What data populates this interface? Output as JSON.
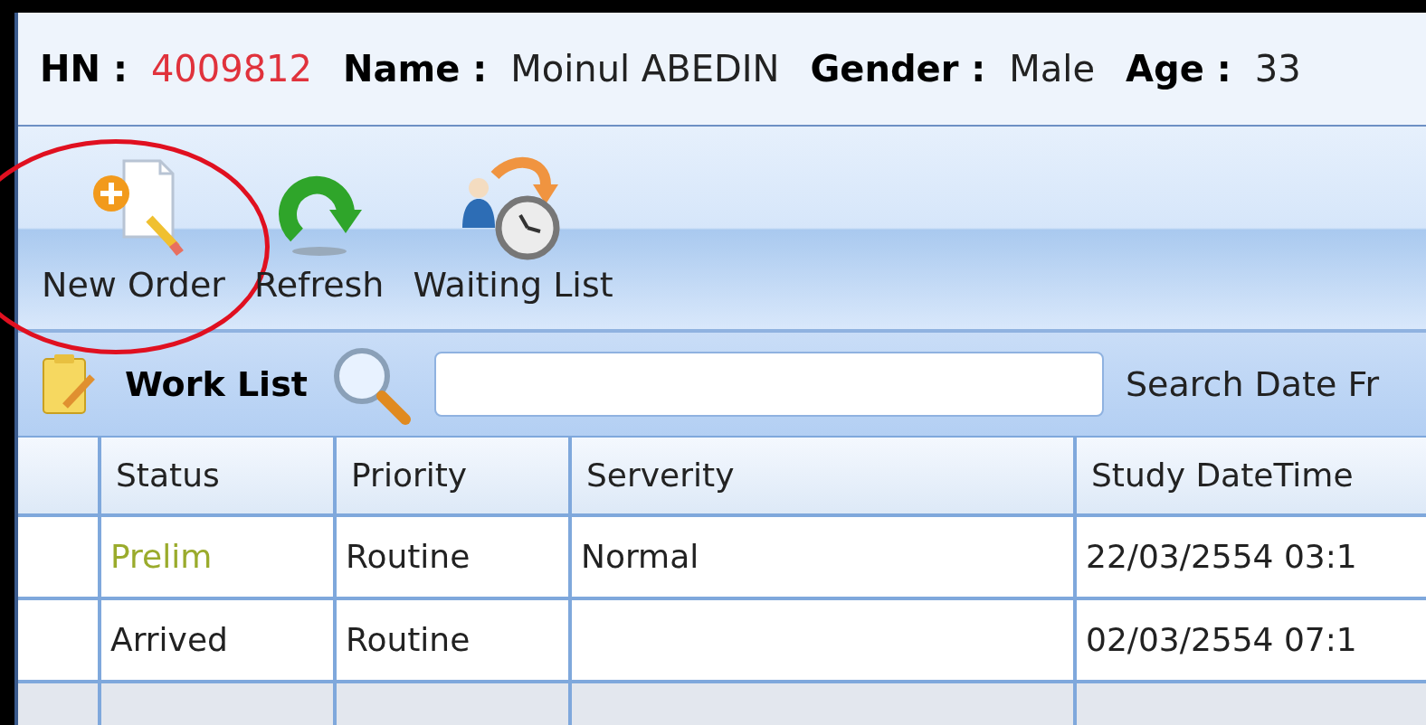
{
  "patient": [
    {
      "label": "HN :",
      "value": "4009812",
      "kind": "id"
    },
    {
      "label": "Name :",
      "value": "Moinul ABEDIN",
      "kind": "text"
    },
    {
      "label": "Gender :",
      "value": "Male",
      "kind": "text"
    },
    {
      "label": "Age :",
      "value": "33",
      "kind": "text"
    }
  ],
  "toolbar": [
    {
      "label": "New Order",
      "kind": "new-doc",
      "circled": true
    },
    {
      "label": "Refresh",
      "kind": "refresh",
      "circled": false
    },
    {
      "label": "Waiting List",
      "kind": "waiting",
      "circled": false
    }
  ],
  "work_list": {
    "title": "Work List",
    "date_label": "Search Date Fr"
  },
  "table": {
    "columns": [
      "",
      "Status",
      "Priority",
      "Serverity",
      "Study DateTime"
    ],
    "rows": [
      {
        "color": "#9aab2c",
        "cells": [
          "",
          "Prelim",
          "Routine",
          "Normal",
          "22/03/2554 03:1"
        ]
      },
      {
        "color": "#222222",
        "cells": [
          "",
          "Arrived",
          "Routine",
          "",
          "02/03/2554 07:1"
        ]
      }
    ]
  }
}
